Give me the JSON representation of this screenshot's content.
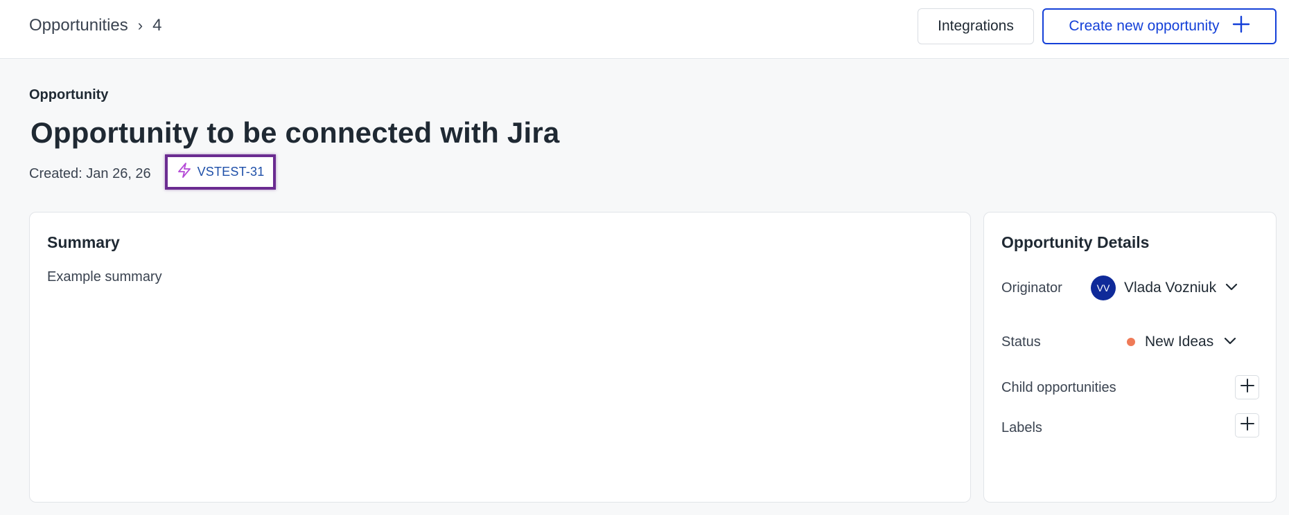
{
  "breadcrumb": {
    "parent": "Opportunities",
    "separator": "›",
    "current": "4"
  },
  "header": {
    "integrations_label": "Integrations",
    "create_label": "Create new opportunity"
  },
  "page": {
    "eyebrow": "Opportunity",
    "title": "Opportunity to be connected with Jira",
    "created": "Created: Jan 26, 26",
    "jira_key": "VSTEST-31"
  },
  "summary": {
    "title": "Summary",
    "text": "Example summary"
  },
  "details": {
    "title": "Opportunity Details",
    "originator_label": "Originator",
    "originator_initials": "VV",
    "originator_name": "Vlada Vozniuk",
    "status_label": "Status",
    "status_value": "New Ideas",
    "child_label": "Child opportunities",
    "labels_label": "Labels"
  },
  "colors": {
    "accent": "#1440d8",
    "avatar": "#0f2a99",
    "status_dot": "#ef7a57",
    "highlight_border": "#6b2c91",
    "jira_icon": "#b44ad6"
  },
  "icons": {
    "create": "plus-icon",
    "jira": "lightning-bolt-icon",
    "dropdown": "chevron-down-icon",
    "add": "plus-icon"
  }
}
